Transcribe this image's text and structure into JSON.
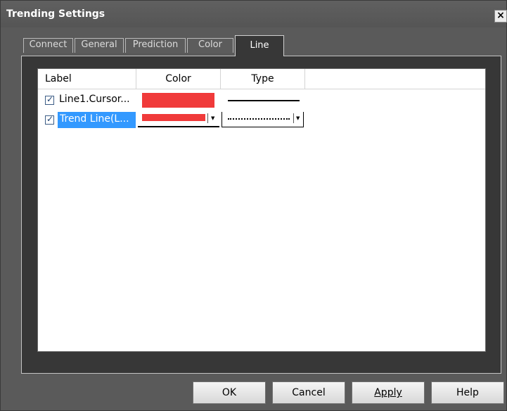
{
  "window": {
    "title": "Trending Settings",
    "close_label": "×"
  },
  "tabs": [
    {
      "label": "Connect"
    },
    {
      "label": "General"
    },
    {
      "label": "Prediction"
    },
    {
      "label": "Color"
    },
    {
      "label": "Line",
      "active": true
    }
  ],
  "table": {
    "columns": [
      "Label",
      "Color",
      "Type"
    ],
    "rows": [
      {
        "label": "Line1.Cursor...",
        "checked": true,
        "color": "#f03a3a",
        "type": "solid",
        "selected": false
      },
      {
        "label": "Trend Line(L...",
        "checked": true,
        "color": "#f03a3a",
        "type": "dotted",
        "selected": true
      }
    ]
  },
  "buttons": {
    "ok": "OK",
    "cancel": "Cancel",
    "apply": "Apply",
    "help": "Help"
  },
  "colors": {
    "window_bg": "#5a5a5a",
    "panel_bg": "#373737",
    "selection": "#3399ff",
    "swatch_red": "#f03a3a"
  },
  "icons": {
    "checkbox_mark": "✓",
    "dropdown_arrow": "▼"
  }
}
